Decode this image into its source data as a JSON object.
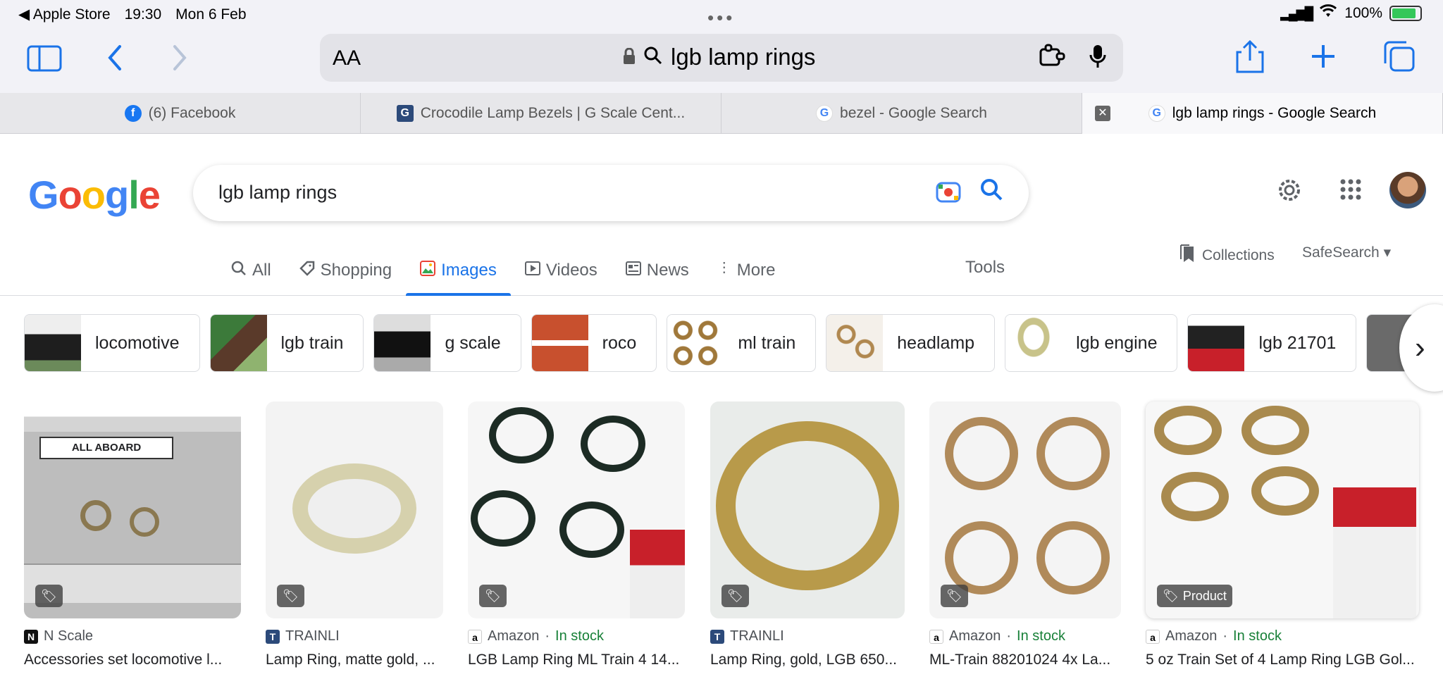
{
  "status_bar": {
    "back_app": "Apple Store",
    "time": "19:30",
    "date": "Mon 6 Feb",
    "battery": "100%"
  },
  "toolbar": {
    "text_size": "AA",
    "url_text": "lgb lamp rings"
  },
  "browser_tabs": [
    {
      "label": "(6) Facebook",
      "icon": "facebook-icon"
    },
    {
      "label": "Crocodile Lamp Bezels | G Scale Cent...",
      "icon": "gscale-icon"
    },
    {
      "label": "bezel - Google Search",
      "icon": "google-icon"
    },
    {
      "label": "lgb lamp rings - Google Search",
      "icon": "google-icon"
    }
  ],
  "google": {
    "logo": "Google",
    "query": "lgb lamp rings",
    "nav": [
      "All",
      "Shopping",
      "Images",
      "Videos",
      "News",
      "More"
    ],
    "tools": "Tools",
    "collections": "Collections",
    "safesearch": "SafeSearch"
  },
  "chips": [
    "locomotive",
    "lgb train",
    "g scale",
    "roco",
    "ml train",
    "headlamp",
    "lgb engine",
    "lgb 21701"
  ],
  "results": [
    {
      "source": "N Scale",
      "stock": "",
      "title": "Accessories set locomotive l...",
      "tag": ""
    },
    {
      "source": "TRAINLI",
      "stock": "",
      "title": "Lamp Ring, matte gold, ...",
      "tag": ""
    },
    {
      "source": "Amazon",
      "stock": "In stock",
      "title": "LGB Lamp Ring ML Train 4 14...",
      "tag": ""
    },
    {
      "source": "TRAINLI",
      "stock": "",
      "title": "Lamp Ring, gold, LGB 650...",
      "tag": ""
    },
    {
      "source": "Amazon",
      "stock": "In stock",
      "title": "ML-Train 88201024 4x La...",
      "tag": ""
    },
    {
      "source": "Amazon",
      "stock": "In stock",
      "title": "5 oz Train Set of 4 Lamp Ring LGB Gol...",
      "tag": "Product"
    }
  ],
  "colors": {
    "accent": "#1a73e8",
    "in_stock": "#188038",
    "safari_bg": "#f2f2f7"
  }
}
